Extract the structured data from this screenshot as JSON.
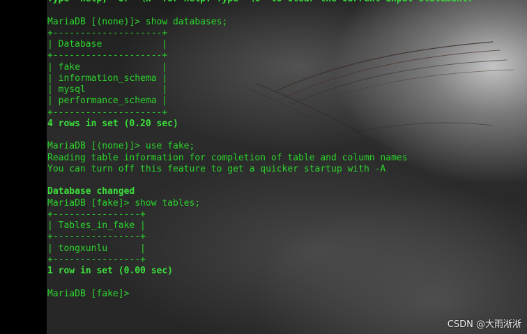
{
  "terminal": {
    "lines": [
      {
        "text": "Type 'help;' or '\\h' for help. Type '\\c' to clear the current input statement.",
        "bold": true
      },
      {
        "text": "",
        "bold": false
      },
      {
        "text": "MariaDB [(none)]> show databases;",
        "bold": false
      },
      {
        "text": "+--------------------+",
        "bold": false
      },
      {
        "text": "| Database           |",
        "bold": false
      },
      {
        "text": "+--------------------+",
        "bold": false
      },
      {
        "text": "| fake               |",
        "bold": false
      },
      {
        "text": "| information_schema |",
        "bold": false
      },
      {
        "text": "| mysql              |",
        "bold": false
      },
      {
        "text": "| performance_schema |",
        "bold": false
      },
      {
        "text": "+--------------------+",
        "bold": false
      },
      {
        "text": "4 rows in set (0.20 sec)",
        "bold": true
      },
      {
        "text": "",
        "bold": false
      },
      {
        "text": "MariaDB [(none)]> use fake;",
        "bold": false
      },
      {
        "text": "Reading table information for completion of table and column names",
        "bold": false
      },
      {
        "text": "You can turn off this feature to get a quicker startup with -A",
        "bold": false
      },
      {
        "text": "",
        "bold": false
      },
      {
        "text": "Database changed",
        "bold": true
      },
      {
        "text": "MariaDB [fake]> show tables;",
        "bold": false
      },
      {
        "text": "+----------------+",
        "bold": false
      },
      {
        "text": "| Tables_in_fake |",
        "bold": false
      },
      {
        "text": "+----------------+",
        "bold": false
      },
      {
        "text": "| tongxunlu      |",
        "bold": false
      },
      {
        "text": "+----------------+",
        "bold": false
      },
      {
        "text": "1 row in set (0.00 sec)",
        "bold": true
      },
      {
        "text": "",
        "bold": false
      },
      {
        "text": "MariaDB [fake]>",
        "bold": false
      }
    ],
    "text_color": "#2bd42b"
  },
  "watermark": "CSDN @大雨淅淅"
}
